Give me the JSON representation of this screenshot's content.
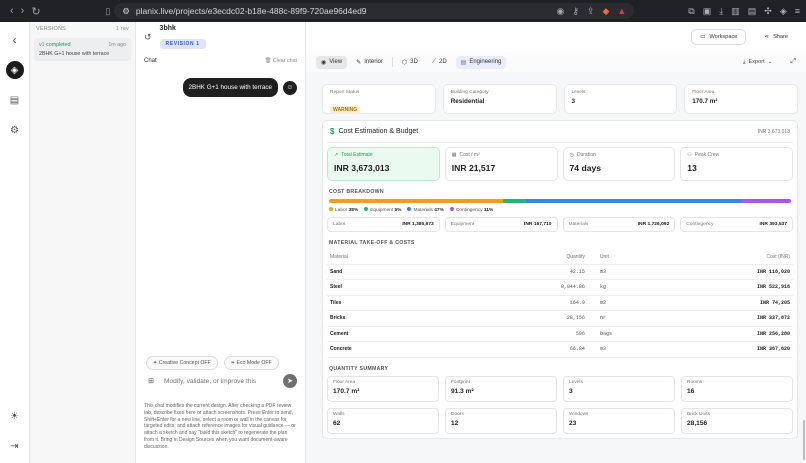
{
  "browser": {
    "url": "planix.live/projects/e3ecdc02-b18e-488c-89f9-720ae96d4ed9"
  },
  "versions": {
    "title": "VERSIONS",
    "count": "1 rev",
    "items": [
      {
        "tag": "v1",
        "status": "completed",
        "time": "1m ago",
        "label": "2BHK G+1 house with terrace"
      }
    ]
  },
  "project": {
    "name": "3bhk",
    "revision": "REVISION 1"
  },
  "chat": {
    "title": "Chat",
    "clear_label": "Clear chat",
    "message": "2BHK G+1 house with terrace",
    "chip_creative": "Creative Concept OFF",
    "chip_eco": "Eco Mode OFF",
    "placeholder": "Modify, validate, or improve this",
    "help": "This chat modifies the current design. After checking a PDF review tab, describe fixes here or attach screenshots. Press Enter to send, Shift+Enter for a new line, select a room or wall in the canvas for targeted edits, and attach reference images for visual guidance — or attach a sketch and say \"build this sketch\" to regenerate the plan from it. Bring in Design Sources when you want document-aware discussion."
  },
  "topbar": {
    "workspace": "Workspace",
    "share": "Share"
  },
  "viewbar": {
    "view": "View",
    "interior": "Interior",
    "v3d": "3D",
    "v2d": "2D",
    "engineering": "Engineering",
    "export": "Export"
  },
  "info": [
    {
      "label": "Report Status",
      "value": "WARNING"
    },
    {
      "label": "Building Category",
      "value": "Residential"
    },
    {
      "label": "Levels",
      "value": "3"
    },
    {
      "label": "Floor Area",
      "value": "170.7 m²"
    }
  ],
  "cost": {
    "title": "Cost Estimation & Budget",
    "total_right": "INR 3,673,013",
    "metrics": [
      {
        "label": "Total Estimate",
        "value": "INR 3,673,013"
      },
      {
        "label": "Cost / m²",
        "value": "INR 21,517"
      },
      {
        "label": "Duration",
        "value": "74 days"
      },
      {
        "label": "Peak Crew",
        "value": "13"
      }
    ],
    "breakdown_title": "COST BREAKDOWN",
    "breakdown": [
      {
        "name": "Labor",
        "pct": "38%",
        "pct_value": 38,
        "color": "#f29d22",
        "amount": "INR 1,385,673"
      },
      {
        "name": "Equipment",
        "pct": "5%",
        "pct_value": 5,
        "color": "#1fb87a",
        "amount": "INR 167,710"
      },
      {
        "name": "Materials",
        "pct": "47%",
        "pct_value": 47,
        "color": "#3c82f0",
        "amount": "INR 1,726,092"
      },
      {
        "name": "Contingency",
        "pct": "11%",
        "pct_value": 11,
        "color": "#a855f7",
        "amount": "INR 393,537"
      }
    ],
    "material_title": "MATERIAL TAKE-OFF & COSTS",
    "material_headers": [
      "Material",
      "Quantity",
      "Unit",
      "Cost (INR)"
    ],
    "materials": [
      {
        "material": "Sand",
        "quantity": "42.15",
        "unit": "m3",
        "cost": "INR 118,020"
      },
      {
        "material": "Steel",
        "quantity": "8,044.86",
        "unit": "kg",
        "cost": "INR 522,916"
      },
      {
        "material": "Tiles",
        "quantity": "164.9",
        "unit": "m2",
        "cost": "INR 74,205"
      },
      {
        "material": "Bricks",
        "quantity": "28,156",
        "unit": "nr",
        "cost": "INR 337,872"
      },
      {
        "material": "Cement",
        "quantity": "596",
        "unit": "bags",
        "cost": "INR 256,280"
      },
      {
        "material": "Concrete",
        "quantity": "66.84",
        "unit": "m3",
        "cost": "INR 367,620"
      }
    ]
  },
  "quantity": {
    "title": "QUANTITY SUMMARY",
    "items": [
      {
        "label": "Floor Area",
        "value": "170.7 m²"
      },
      {
        "label": "Footprint",
        "value": "91.3 m²"
      },
      {
        "label": "Levels",
        "value": "3"
      },
      {
        "label": "Rooms",
        "value": "16"
      },
      {
        "label": "Walls",
        "value": "62"
      },
      {
        "label": "Doors",
        "value": "12"
      },
      {
        "label": "Windows",
        "value": "23"
      },
      {
        "label": "Brick Units",
        "value": "28,156"
      }
    ]
  }
}
